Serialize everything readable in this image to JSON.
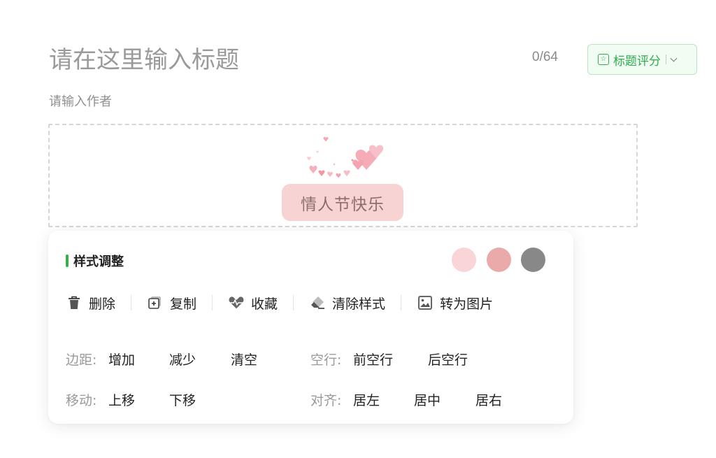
{
  "header": {
    "title_placeholder": "请在这里输入标题",
    "counter": "0/64",
    "score_button_label": "标题评分",
    "author_placeholder": "请输入作者"
  },
  "content": {
    "badge_text": "情人节快乐"
  },
  "panel": {
    "title": "样式调整",
    "swatches": [
      "#fad5d7",
      "#ebaaaa",
      "#888888"
    ],
    "toolbar": {
      "delete": "删除",
      "copy": "复制",
      "favorite": "收藏",
      "clear_style": "清除样式",
      "to_image": "转为图片"
    },
    "options": {
      "margin_label": "边距:",
      "margin_add": "增加",
      "margin_reduce": "减少",
      "margin_clear": "清空",
      "blank_label": "空行:",
      "blank_before": "前空行",
      "blank_after": "后空行",
      "move_label": "移动:",
      "move_up": "上移",
      "move_down": "下移",
      "align_label": "对齐:",
      "align_left": "居左",
      "align_center": "居中",
      "align_right": "居右"
    }
  },
  "colors": {
    "accent_green": "#2fae4e",
    "badge_bg": "#f8d3d3"
  }
}
